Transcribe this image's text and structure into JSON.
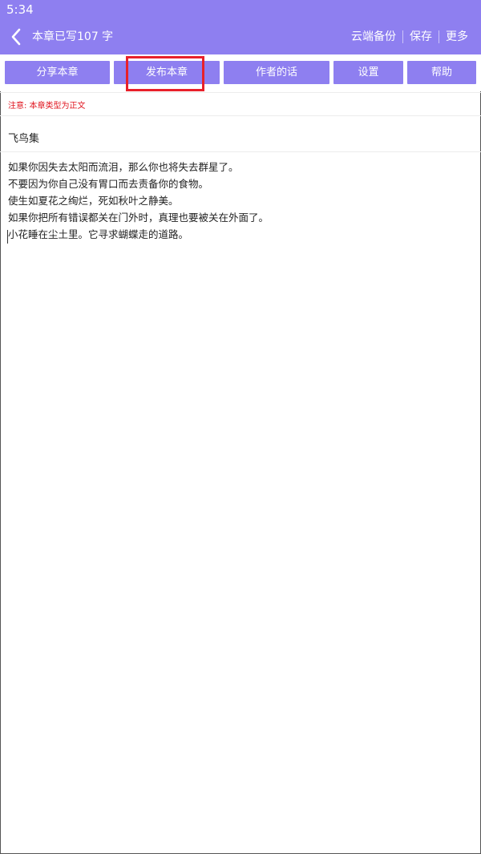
{
  "status_bar": {
    "time": "5:34"
  },
  "app_bar": {
    "title": "本章已写107 字",
    "actions": [
      "云端备份",
      "保存",
      "更多"
    ]
  },
  "toolbar": {
    "buttons": [
      "分享本章",
      "发布本章",
      "作者的话",
      "设置",
      "帮助"
    ],
    "highlighted": "发布本章"
  },
  "notice": "注意: 本章类型为正文",
  "chapter": {
    "title": "飞鸟集",
    "lines": [
      "如果你因失去太阳而流泪，那么你也将失去群星了。",
      "不要因为你自己没有胃口而去责备你的食物。",
      "使生如夏花之绚烂，死如秋叶之静美。",
      "如果你把所有错误都关在门外时，真理也要被关在外面了。",
      "小花睡在尘土里。它寻求蝴蝶走的道路。"
    ]
  },
  "colors": {
    "accent": "#8e7ff0",
    "notice": "#e0141e",
    "highlight": "#e8202a"
  }
}
